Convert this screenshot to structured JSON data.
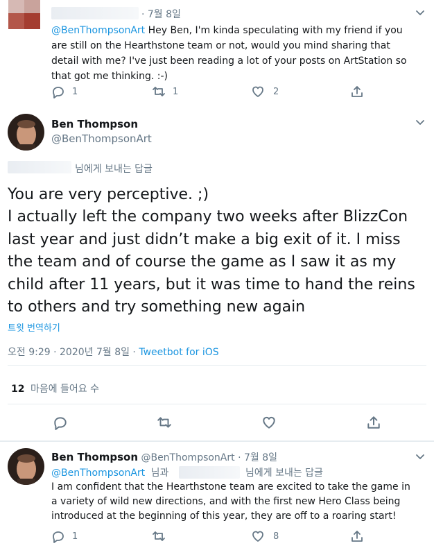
{
  "tweet1": {
    "time": "· 7월 8일",
    "mention": "@BenThompsonArt",
    "text_lines": [
      " Hey Ben, I'm kinda speculating with my friend if you",
      "are still on the Hearthstone team or not, would you mind sharing that",
      "detail with me? I've just been reading a lot of your posts on ArtStation so",
      "that got me thinking. :-)"
    ],
    "reply_count": "1",
    "retweet_count": "1",
    "like_count": "2"
  },
  "main_tweet": {
    "author_name": "Ben Thompson",
    "author_handle": "@BenThompsonArt",
    "reply_to_suffix": "님에게 보내는 답글",
    "body_lines": [
      "You are very perceptive. ;)",
      "I actually left the company two weeks after BlizzCon",
      "last year and just didn’t make a big exit of it. I miss",
      "the team and of course the game as I saw it as my",
      "child after 11 years, but it was time to hand the reins",
      "to others and try something new again"
    ],
    "translate": "트윗 번역하기",
    "timestamp": "오전 9:29 · 2020년 7월 8일 · ",
    "source": "Tweetbot for iOS",
    "likes_count": "12",
    "likes_label": "마음에 들어요 수"
  },
  "tweet3": {
    "author_name": "Ben Thompson",
    "author_handle": "@BenThompsonArt",
    "time": "· 7월 8일",
    "mention": "@BenThompsonArt",
    "and_label": "님과",
    "reply_to_suffix": "님에게 보내는 답글",
    "text_lines": [
      "I am confident that the Hearthstone team are excited to take the game in",
      "a variety of wild new directions, and with the first new Hero Class being",
      "introduced at the beginning of this year, they are off to a roaring start!"
    ],
    "reply_count": "1",
    "retweet_count": "",
    "like_count": "8"
  },
  "colors": {
    "link": "#1b95e0",
    "muted": "#657786",
    "text": "#14171a",
    "divider": "#e6ecf0"
  }
}
